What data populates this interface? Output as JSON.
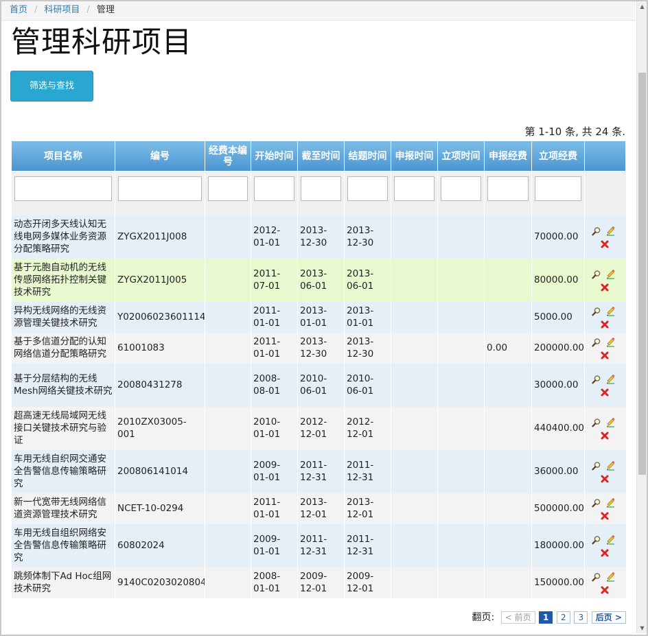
{
  "breadcrumb": {
    "home": "首页",
    "section": "科研项目",
    "current": "管理",
    "separator": "/"
  },
  "page": {
    "title": "管理科研项目",
    "filter_button": "筛选与查找"
  },
  "summary": "第 1-10 条, 共 24 条.",
  "columns": [
    "项目名称",
    "编号",
    "经费本编号",
    "开始时间",
    "截至时间",
    "结题时间",
    "申报时间",
    "立项时间",
    "申报经费",
    "立项经费",
    ""
  ],
  "rows": [
    {
      "name": "动态开闭多天线认知无线电网多媒体业务资源分配策略研究",
      "code": "ZYGX2011J008",
      "budget_no": "",
      "start": "2012-01-01",
      "deadline": "2013-12-30",
      "finish": "2013-12-30",
      "apply_date": "",
      "approve_date": "",
      "apply_fund": "",
      "approved_fund": "70000.00"
    },
    {
      "name": "基于元胞自动机的无线传感网络拓扑控制关键技术研究",
      "code": "ZYGX2011J005",
      "budget_no": "",
      "start": "2011-07-01",
      "deadline": "2013-06-01",
      "finish": "2013-06-01",
      "apply_date": "",
      "approve_date": "",
      "apply_fund": "",
      "approved_fund": "80000.00"
    },
    {
      "name": "异构无线网络的无线资源管理关键技术研究",
      "code": "Y02006023601114",
      "budget_no": "",
      "start": "2011-01-01",
      "deadline": "2013-01-01",
      "finish": "2013-01-01",
      "apply_date": "",
      "approve_date": "",
      "apply_fund": "",
      "approved_fund": "5000.00"
    },
    {
      "name": "基于多信道分配的认知网络信道分配策略研究",
      "code": "61001083",
      "budget_no": "",
      "start": "2011-01-01",
      "deadline": "2013-12-30",
      "finish": "2013-12-30",
      "apply_date": "",
      "approve_date": "",
      "apply_fund": "0.00",
      "approved_fund": "200000.00"
    },
    {
      "name": "基于分层结构的无线Mesh网络关键技术研究",
      "code": "20080431278",
      "budget_no": "",
      "start": "2008-08-01",
      "deadline": "2010-06-01",
      "finish": "2010-06-01",
      "apply_date": "",
      "approve_date": "",
      "apply_fund": "",
      "approved_fund": "30000.00"
    },
    {
      "name": "超高速无线局域网无线接口关键技术研究与验证",
      "code": "2010ZX03005-001",
      "budget_no": "",
      "start": "2010-01-01",
      "deadline": "2012-12-01",
      "finish": "2012-12-01",
      "apply_date": "",
      "approve_date": "",
      "apply_fund": "",
      "approved_fund": "440400.00"
    },
    {
      "name": "车用无线自织网交通安全告警信息传输策略研究",
      "code": "200806141014",
      "budget_no": "",
      "start": "2009-01-01",
      "deadline": "2011-12-31",
      "finish": "2011-12-31",
      "apply_date": "",
      "approve_date": "",
      "apply_fund": "",
      "approved_fund": "36000.00"
    },
    {
      "name": "新一代宽带无线网络信道资源管理技术研究",
      "code": "NCET-10-0294",
      "budget_no": "",
      "start": "2011-01-01",
      "deadline": "2013-12-01",
      "finish": "2013-12-01",
      "apply_date": "",
      "approve_date": "",
      "apply_fund": "",
      "approved_fund": "500000.00"
    },
    {
      "name": "车用无线自组织网络安全告警信息传输策略研究",
      "code": "60802024",
      "budget_no": "",
      "start": "2009-01-01",
      "deadline": "2011-12-31",
      "finish": "2011-12-31",
      "apply_date": "",
      "approve_date": "",
      "apply_fund": "",
      "approved_fund": "180000.00"
    },
    {
      "name": "跳频体制下Ad Hoc组网技术研究",
      "code": "9140C0203020804",
      "budget_no": "",
      "start": "2008-01-01",
      "deadline": "2009-12-01",
      "finish": "2009-12-01",
      "apply_date": "",
      "approve_date": "",
      "apply_fund": "",
      "approved_fund": "150000.00"
    }
  ],
  "row_icons": {
    "view": "magnifier-icon",
    "edit": "pencil-icon",
    "delete": "delete-x-icon"
  },
  "pager": {
    "label": "翻页:",
    "prev": "< 前页",
    "pages": [
      "1",
      "2",
      "3"
    ],
    "active": "1",
    "next": "后页 >"
  },
  "colors": {
    "header_top": "#7cbde8",
    "header_bottom": "#4a95cf",
    "button": "#2aa7d0",
    "row_highlight": "#e8f8cf",
    "row_odd": "#e4eff7",
    "row_even": "#f3f3f3",
    "pager_active": "#1e5aa8"
  }
}
